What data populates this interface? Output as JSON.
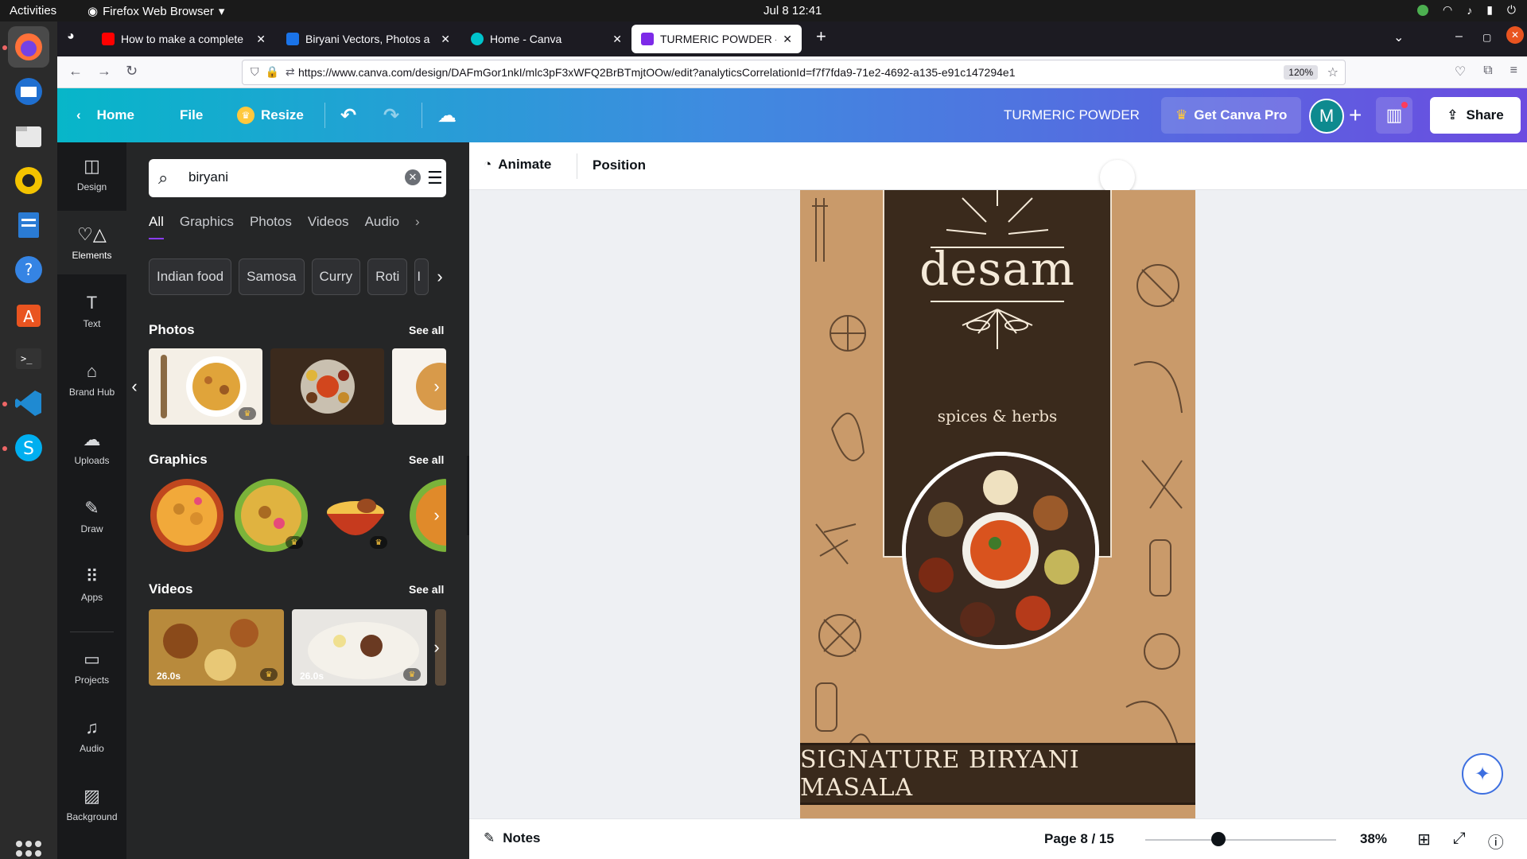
{
  "system": {
    "activities": "Activities",
    "app_menu": "Firefox Web Browser",
    "clock": "Jul 8  12:41"
  },
  "browser": {
    "tabs": [
      {
        "title": "How to make a complete",
        "color": "#ff0000"
      },
      {
        "title": "Biryani Vectors, Photos a",
        "color": "#1a73e8"
      },
      {
        "title": "Home - Canva",
        "color": "#00c4cc"
      },
      {
        "title": "TURMERIC POWDER - Yo",
        "color": "#7d2ae8"
      }
    ],
    "url": "https://www.canva.com/design/DAFmGor1nkI/mlc3pF3xWFQ2BrBTmjtOOw/edit?analyticsCorrelationId=f7f7fda9-71e2-4692-a135-e91c147294e1",
    "url_domain": "canva.com",
    "zoom": "120%"
  },
  "canva_header": {
    "home": "Home",
    "file": "File",
    "resize": "Resize",
    "design_title": "TURMERIC POWDER",
    "get_pro": "Get Canva Pro",
    "avatar_letter": "M",
    "share": "Share"
  },
  "rail": [
    {
      "label": "Design",
      "icon": "layout-icon"
    },
    {
      "label": "Elements",
      "icon": "shapes-icon"
    },
    {
      "label": "Text",
      "icon": "text-icon"
    },
    {
      "label": "Brand Hub",
      "icon": "brand-icon"
    },
    {
      "label": "Uploads",
      "icon": "cloud-upload-icon"
    },
    {
      "label": "Draw",
      "icon": "pen-icon"
    },
    {
      "label": "Apps",
      "icon": "apps-icon"
    },
    {
      "label": "Projects",
      "icon": "folder-icon"
    },
    {
      "label": "Audio",
      "icon": "music-icon"
    },
    {
      "label": "Background",
      "icon": "background-icon"
    }
  ],
  "panel": {
    "search_value": "biryani",
    "tabs": [
      "All",
      "Graphics",
      "Photos",
      "Videos",
      "Audio"
    ],
    "chips": [
      "Indian food",
      "Samosa",
      "Curry",
      "Roti",
      "I"
    ],
    "photos_title": "Photos",
    "graphics_title": "Graphics",
    "videos_title": "Videos",
    "see_all": "See all",
    "video_durations": [
      "26.0s",
      "26.0s"
    ]
  },
  "editor": {
    "animate": "Animate",
    "position": "Position",
    "brand": "desam",
    "tagline": "spices & herbs",
    "product_title": "SIGNATURE BIRYANI MASALA",
    "notes": "Notes",
    "page_info": "Page 8 / 15",
    "zoom": "38%",
    "zoom_level": 0.38
  },
  "colors": {
    "header_gradient_start": "#07b6c9",
    "header_gradient_end": "#6b4ce0",
    "panel_bg": "#252627",
    "rail_bg": "#18191b",
    "design_tan": "#c99a6a",
    "design_dark": "#3a2a1c"
  }
}
